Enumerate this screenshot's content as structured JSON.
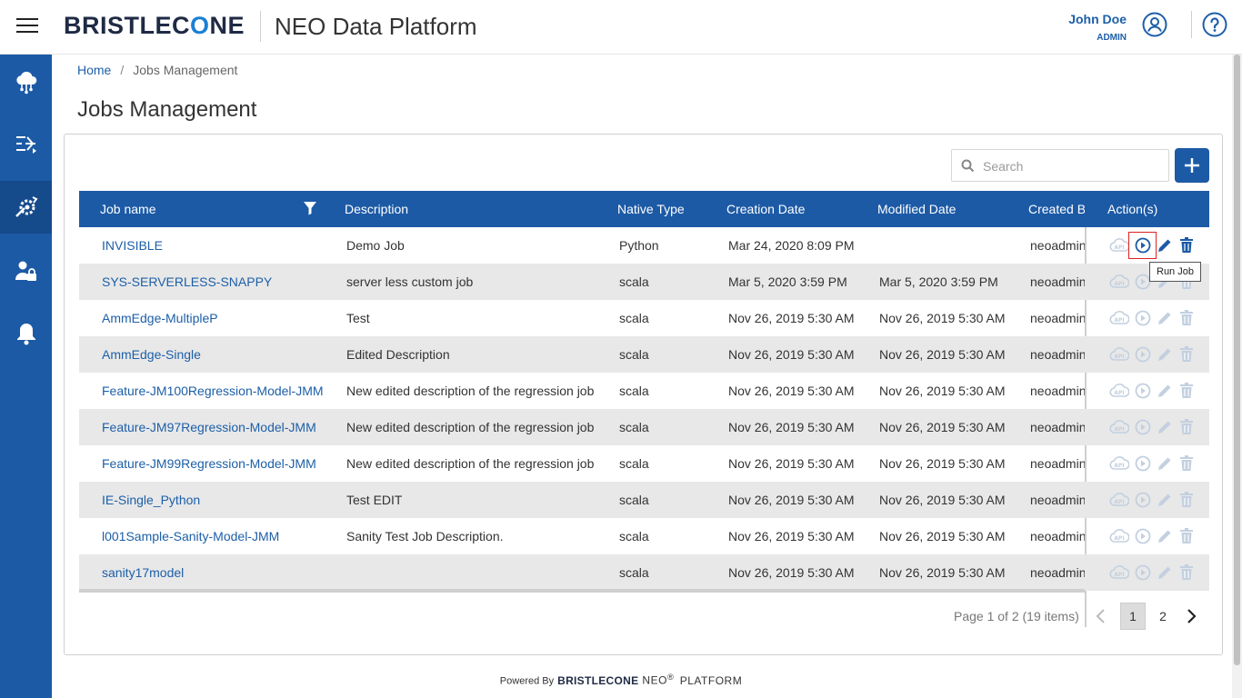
{
  "header": {
    "logo_text_left": "BRISTLEC",
    "logo_text_o": "O",
    "logo_text_right": "NE",
    "app_title": "NEO Data Platform",
    "user_name": "John Doe",
    "user_role": "ADMIN"
  },
  "sidebar": {
    "items": [
      {
        "icon": "cloud-network-icon"
      },
      {
        "icon": "data-flow-icon"
      },
      {
        "icon": "jobs-settings-icon",
        "active": true
      },
      {
        "icon": "user-admin-icon"
      },
      {
        "icon": "bell-icon"
      }
    ]
  },
  "breadcrumb": {
    "home": "Home",
    "separator": "/",
    "current": "Jobs Management"
  },
  "page_title": "Jobs Management",
  "search": {
    "placeholder": "Search",
    "value": ""
  },
  "table": {
    "headers": {
      "job_name": "Job name",
      "description": "Description",
      "native_type": "Native Type",
      "creation_date": "Creation Date",
      "modified_date": "Modified Date",
      "created_by": "Created By",
      "actions": "Action(s)"
    },
    "rows": [
      {
        "name": "INVISIBLE",
        "description": "Demo Job",
        "type": "Python",
        "created": "Mar 24, 2020 8:09 PM",
        "modified": "",
        "by": "neoadmin"
      },
      {
        "name": "SYS-SERVERLESS-SNAPPY",
        "description": "server less custom job",
        "type": "scala",
        "created": "Mar 5, 2020 3:59 PM",
        "modified": "Mar 5, 2020 3:59 PM",
        "by": "neoadmin"
      },
      {
        "name": "AmmEdge-MultipleP",
        "description": "Test",
        "type": "scala",
        "created": "Nov 26, 2019 5:30 AM",
        "modified": "Nov 26, 2019 5:30 AM",
        "by": "neoadmin"
      },
      {
        "name": "AmmEdge-Single",
        "description": "Edited Description",
        "type": "scala",
        "created": "Nov 26, 2019 5:30 AM",
        "modified": "Nov 26, 2019 5:30 AM",
        "by": "neoadmin"
      },
      {
        "name": "Feature-JM100Regression-Model-JMM",
        "description": "New edited description of the regression job",
        "type": "scala",
        "created": "Nov 26, 2019 5:30 AM",
        "modified": "Nov 26, 2019 5:30 AM",
        "by": "neoadmin"
      },
      {
        "name": "Feature-JM97Regression-Model-JMM",
        "description": "New edited description of the regression job",
        "type": "scala",
        "created": "Nov 26, 2019 5:30 AM",
        "modified": "Nov 26, 2019 5:30 AM",
        "by": "neoadmin"
      },
      {
        "name": "Feature-JM99Regression-Model-JMM",
        "description": "New edited description of the regression job",
        "type": "scala",
        "created": "Nov 26, 2019 5:30 AM",
        "modified": "Nov 26, 2019 5:30 AM",
        "by": "neoadmin"
      },
      {
        "name": "IE-Single_Python",
        "description": "Test EDIT",
        "type": "scala",
        "created": "Nov 26, 2019 5:30 AM",
        "modified": "Nov 26, 2019 5:30 AM",
        "by": "neoadmin"
      },
      {
        "name": "l001Sample-Sanity-Model-JMM",
        "description": "Sanity Test Job Description.",
        "type": "scala",
        "created": "Nov 26, 2019 5:30 AM",
        "modified": "Nov 26, 2019 5:30 AM",
        "by": "neoadmin"
      },
      {
        "name": "sanity17model",
        "description": "",
        "type": "scala",
        "created": "Nov 26, 2019 5:30 AM",
        "modified": "Nov 26, 2019 5:30 AM",
        "by": "neoadmin"
      }
    ]
  },
  "tooltip": "Run Job",
  "pagination": {
    "info": "Page 1 of 2 (19 items)",
    "pages": [
      "1",
      "2"
    ],
    "current": "1"
  },
  "footer": {
    "powered_by": "Powered By",
    "brand": "BRISTLECONE",
    "neo": "NEO",
    "reg": "®",
    "platform": "PLATFORM"
  },
  "colors": {
    "primary": "#1c5aa6",
    "link": "#1d5fa8",
    "row_alt": "#e8e8e8",
    "action_active": "#1c5aa6",
    "action_disabled": "#c3d0e0"
  }
}
